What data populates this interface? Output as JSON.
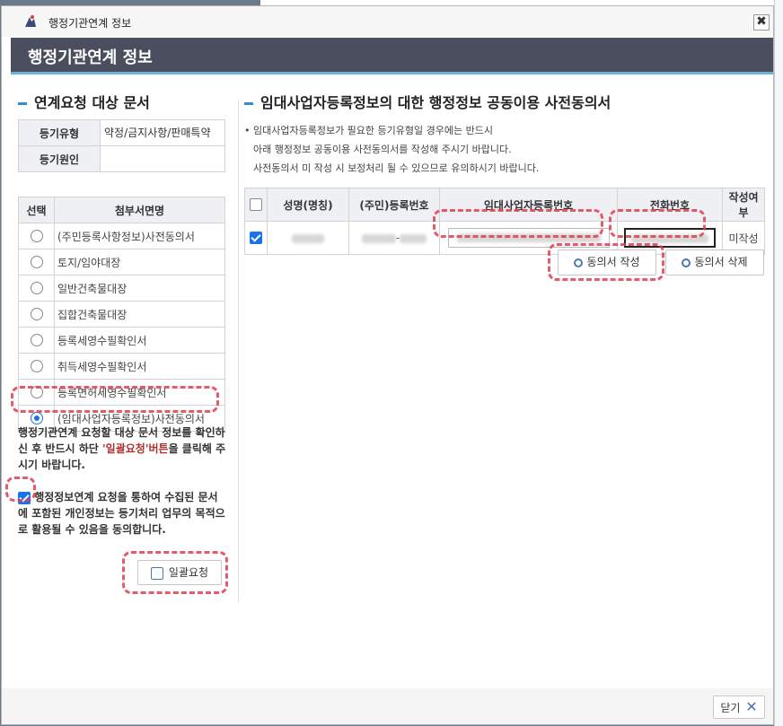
{
  "window": {
    "title": "행정기관연계 정보",
    "close_label": "✖"
  },
  "header": {
    "title": "행정기관연계 정보"
  },
  "left": {
    "section_title": "연계요청 대상 문서",
    "info": [
      {
        "key": "등기유형",
        "value": "약정/금지사항/판매특약"
      },
      {
        "key": "등기원인",
        "value": ""
      }
    ],
    "docs_headers": [
      "선택",
      "첨부서면명"
    ],
    "docs": [
      {
        "name": "(주민등록사항정보)사전동의서",
        "selected": false
      },
      {
        "name": "토지/임야대장",
        "selected": false
      },
      {
        "name": "일반건축물대장",
        "selected": false
      },
      {
        "name": "집합건축물대장",
        "selected": false
      },
      {
        "name": "등록세영수필확인서",
        "selected": false
      },
      {
        "name": "취득세영수필확인서",
        "selected": false
      },
      {
        "name": "등록면허세영수필확인서",
        "selected": false
      },
      {
        "name": "(임대사업자등록정보)사전동의서",
        "selected": true
      }
    ],
    "notice_part1": "행정기관연계 요청할 대상 문서 정보를 확인하신 후 반드시 하단 ",
    "notice_red": "'일괄요청'버튼",
    "notice_part2": "을 클릭해 주시기 바랍니다.",
    "consent_text": "행정정보연계 요청을 통하여 수집된 문서에 포함된 개인정보는 등기처리 업무의 목적으로 활용될 수 있음을 동의합니다.",
    "bulk_button": "일괄요청"
  },
  "right": {
    "section_title": "임대사업자등록정보의 대한 행정정보 공동이용 사전동의서",
    "info_lines": [
      "• 임대사업자등록정보가 필요한 등기유형일 경우에는 반드시",
      "아래 행정정보 공동이용 사전동의서를 작성해 주시기 바랍니다.",
      "사전동의서 미 작성 시 보정처리 될 수 있으므로 유의하시기 바랍니다."
    ],
    "table_headers": [
      "성명(명칭)",
      "(주민)등록번호",
      "임대사업자등록번호",
      "전화번호",
      "작성여부"
    ],
    "row": {
      "reg_suffix": "-",
      "status": "미작성"
    },
    "write_button": "동의서 작성",
    "delete_button": "동의서 삭제"
  },
  "footer": {
    "close_button": "닫기"
  }
}
